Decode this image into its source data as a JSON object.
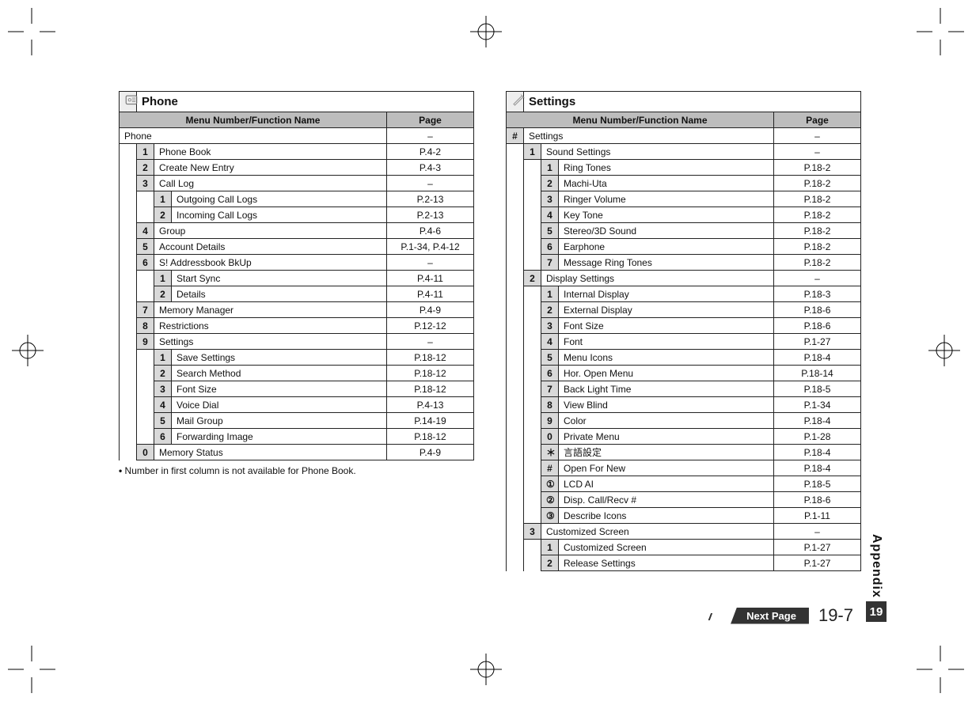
{
  "chapter": {
    "label": "Appendix",
    "number": "19"
  },
  "footer": {
    "next_label": "Next Page",
    "page_number": "19-7"
  },
  "left": {
    "title": "Phone",
    "header_menu": "Menu Number/Function Name",
    "header_page": "Page",
    "note": "Number in first column is not available for Phone Book.",
    "rows": [
      {
        "lvl": 0,
        "num": "",
        "name": "Phone",
        "page": "–"
      },
      {
        "lvl": 1,
        "num": "1",
        "name": "Phone Book",
        "page": "P.4-2"
      },
      {
        "lvl": 1,
        "num": "2",
        "name": "Create New Entry",
        "page": "P.4-3"
      },
      {
        "lvl": 1,
        "num": "3",
        "name": "Call Log",
        "page": "–"
      },
      {
        "lvl": 2,
        "num": "1",
        "name": "Outgoing Call Logs",
        "page": "P.2-13"
      },
      {
        "lvl": 2,
        "num": "2",
        "name": "Incoming Call Logs",
        "page": "P.2-13"
      },
      {
        "lvl": 1,
        "num": "4",
        "name": "Group",
        "page": "P.4-6"
      },
      {
        "lvl": 1,
        "num": "5",
        "name": "Account Details",
        "page": "P.1-34, P.4-12"
      },
      {
        "lvl": 1,
        "num": "6",
        "name": "S! Addressbook BkUp",
        "page": "–"
      },
      {
        "lvl": 2,
        "num": "1",
        "name": "Start Sync",
        "page": "P.4-11"
      },
      {
        "lvl": 2,
        "num": "2",
        "name": "Details",
        "page": "P.4-11"
      },
      {
        "lvl": 1,
        "num": "7",
        "name": "Memory Manager",
        "page": "P.4-9"
      },
      {
        "lvl": 1,
        "num": "8",
        "name": "Restrictions",
        "page": "P.12-12"
      },
      {
        "lvl": 1,
        "num": "9",
        "name": "Settings",
        "page": "–"
      },
      {
        "lvl": 2,
        "num": "1",
        "name": "Save Settings",
        "page": "P.18-12"
      },
      {
        "lvl": 2,
        "num": "2",
        "name": "Search Method",
        "page": "P.18-12"
      },
      {
        "lvl": 2,
        "num": "3",
        "name": "Font Size",
        "page": "P.18-12"
      },
      {
        "lvl": 2,
        "num": "4",
        "name": "Voice Dial",
        "page": "P.4-13"
      },
      {
        "lvl": 2,
        "num": "5",
        "name": "Mail Group",
        "page": "P.14-19"
      },
      {
        "lvl": 2,
        "num": "6",
        "name": "Forwarding Image",
        "page": "P.18-12"
      },
      {
        "lvl": 1,
        "num": "0",
        "name": "Memory Status",
        "page": "P.4-9"
      }
    ]
  },
  "right": {
    "title": "Settings",
    "header_menu": "Menu Number/Function Name",
    "header_page": "Page",
    "rows": [
      {
        "lvl": 0,
        "num": "#",
        "name": "Settings",
        "page": "–"
      },
      {
        "lvl": 1,
        "num": "1",
        "name": "Sound Settings",
        "page": "–"
      },
      {
        "lvl": 2,
        "num": "1",
        "name": "Ring Tones",
        "page": "P.18-2"
      },
      {
        "lvl": 2,
        "num": "2",
        "name": "Machi-Uta",
        "page": "P.18-2"
      },
      {
        "lvl": 2,
        "num": "3",
        "name": "Ringer Volume",
        "page": "P.18-2"
      },
      {
        "lvl": 2,
        "num": "4",
        "name": "Key Tone",
        "page": "P.18-2"
      },
      {
        "lvl": 2,
        "num": "5",
        "name": "Stereo/3D Sound",
        "page": "P.18-2"
      },
      {
        "lvl": 2,
        "num": "6",
        "name": "Earphone",
        "page": "P.18-2"
      },
      {
        "lvl": 2,
        "num": "7",
        "name": "Message Ring Tones",
        "page": "P.18-2"
      },
      {
        "lvl": 1,
        "num": "2",
        "name": "Display Settings",
        "page": "–"
      },
      {
        "lvl": 2,
        "num": "1",
        "name": "Internal Display",
        "page": "P.18-3"
      },
      {
        "lvl": 2,
        "num": "2",
        "name": "External Display",
        "page": "P.18-6"
      },
      {
        "lvl": 2,
        "num": "3",
        "name": "Font Size",
        "page": "P.18-6"
      },
      {
        "lvl": 2,
        "num": "4",
        "name": "Font",
        "page": "P.1-27"
      },
      {
        "lvl": 2,
        "num": "5",
        "name": "Menu Icons",
        "page": "P.18-4"
      },
      {
        "lvl": 2,
        "num": "6",
        "name": "Hor. Open Menu",
        "page": "P.18-14"
      },
      {
        "lvl": 2,
        "num": "7",
        "name": "Back Light Time",
        "page": "P.18-5"
      },
      {
        "lvl": 2,
        "num": "8",
        "name": "View Blind",
        "page": "P.1-34"
      },
      {
        "lvl": 2,
        "num": "9",
        "name": "Color",
        "page": "P.18-4"
      },
      {
        "lvl": 2,
        "num": "0",
        "name": "Private Menu",
        "page": "P.1-28"
      },
      {
        "lvl": 2,
        "num": "＊",
        "name": "言語設定",
        "page": "P.18-4"
      },
      {
        "lvl": 2,
        "num": "#",
        "name": "Open For New",
        "page": "P.18-4"
      },
      {
        "lvl": 2,
        "num": "①",
        "name": "LCD AI",
        "page": "P.18-5"
      },
      {
        "lvl": 2,
        "num": "②",
        "name": "Disp. Call/Recv #",
        "page": "P.18-6"
      },
      {
        "lvl": 2,
        "num": "③",
        "name": "Describe Icons",
        "page": "P.1-11"
      },
      {
        "lvl": 1,
        "num": "3",
        "name": "Customized Screen",
        "page": "–"
      },
      {
        "lvl": 2,
        "num": "1",
        "name": "Customized Screen",
        "page": "P.1-27"
      },
      {
        "lvl": 2,
        "num": "2",
        "name": "Release Settings",
        "page": "P.1-27"
      }
    ]
  }
}
